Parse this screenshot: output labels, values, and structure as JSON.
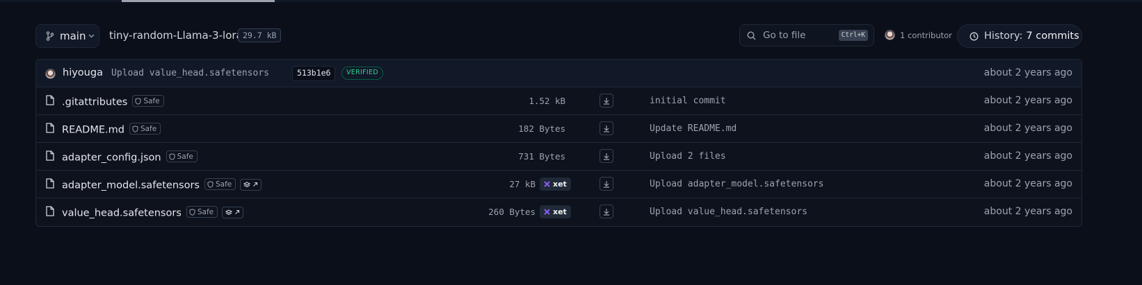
{
  "header": {
    "branch": "main",
    "repo_name": "tiny-random-Llama-3-lora",
    "repo_size": "29.7 kB",
    "goto_placeholder": "Go to file",
    "goto_shortcut": "Ctrl+K",
    "contributors": "1 contributor",
    "history_label": "History:",
    "history_count": "7 commits"
  },
  "last_commit": {
    "author": "hiyouga",
    "message": "Upload value_head.safetensors",
    "hash": "513b1e6",
    "verified": "VERIFIED",
    "when": "about 2 years ago"
  },
  "safe_label": "Safe",
  "xet_label": "xet",
  "files": [
    {
      "name": ".gitattributes",
      "size": "1.52 kB",
      "message": "initial commit",
      "when": "about 2 years ago",
      "lfs": false
    },
    {
      "name": "README.md",
      "size": "182 Bytes",
      "message": "Update README.md",
      "when": "about 2 years ago",
      "lfs": false
    },
    {
      "name": "adapter_config.json",
      "size": "731 Bytes",
      "message": "Upload 2 files",
      "when": "about 2 years ago",
      "lfs": false
    },
    {
      "name": "adapter_model.safetensors",
      "size": "27 kB",
      "message": "Upload adapter_model.safetensors",
      "when": "about 2 years ago",
      "lfs": true
    },
    {
      "name": "value_head.safetensors",
      "size": "260 Bytes",
      "message": "Upload value_head.safetensors",
      "when": "about 2 years ago",
      "lfs": true
    }
  ],
  "icons": {
    "branch": "git-branch-icon",
    "search": "search-icon",
    "history": "clock-icon",
    "file": "file-icon",
    "download": "download-icon",
    "safe": "shield-icon",
    "lfs": "layers-link-icon",
    "xet": "xet-icon"
  }
}
